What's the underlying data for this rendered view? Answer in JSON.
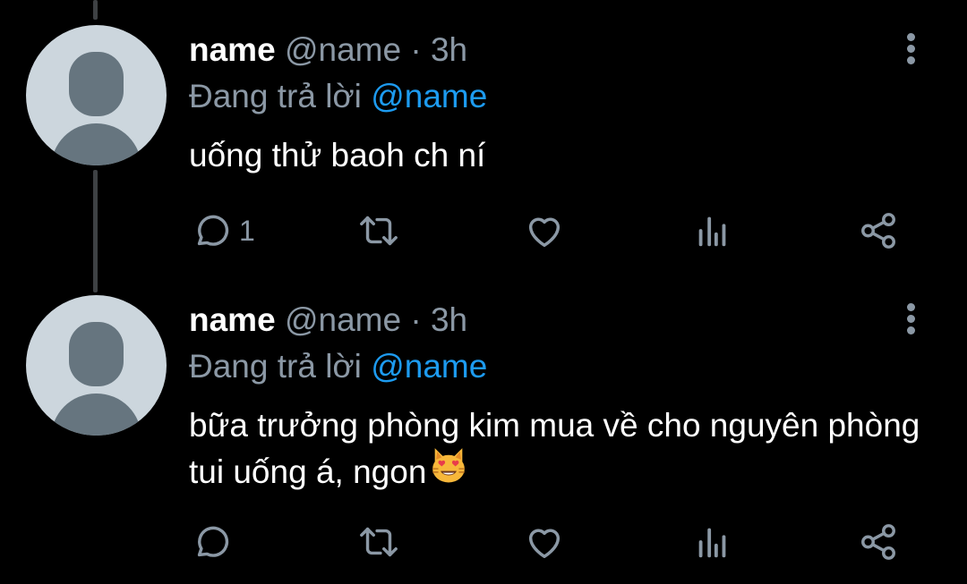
{
  "colors": {
    "background": "#000000",
    "name": "#ffffff",
    "secondary": "#8b98a5",
    "mention": "#1d9bf0",
    "avatar_bg": "#ccd6dd",
    "avatar_fg": "#66757f"
  },
  "tweets": [
    {
      "name": "name",
      "handle": "@name",
      "separator": "·",
      "time": "3h",
      "replying_prefix": "Đang trả lời",
      "replying_to": "@name",
      "text": "uống thử baoh ch ní",
      "reply_count": "1",
      "icons": [
        "reply-icon",
        "retweet-icon",
        "like-icon",
        "analytics-icon",
        "share-icon",
        "more-icon"
      ]
    },
    {
      "name": "name",
      "handle": "@name",
      "separator": "·",
      "time": "3h",
      "replying_prefix": "Đang trả lời",
      "replying_to": "@name",
      "text": "bữa trưởng phòng kim mua về cho nguyên phòng tui uống á, ngon",
      "emoji": "smiling-cat-with-heart-eyes-emoji",
      "reply_count": "",
      "icons": [
        "reply-icon",
        "retweet-icon",
        "like-icon",
        "analytics-icon",
        "share-icon",
        "more-icon"
      ]
    }
  ]
}
